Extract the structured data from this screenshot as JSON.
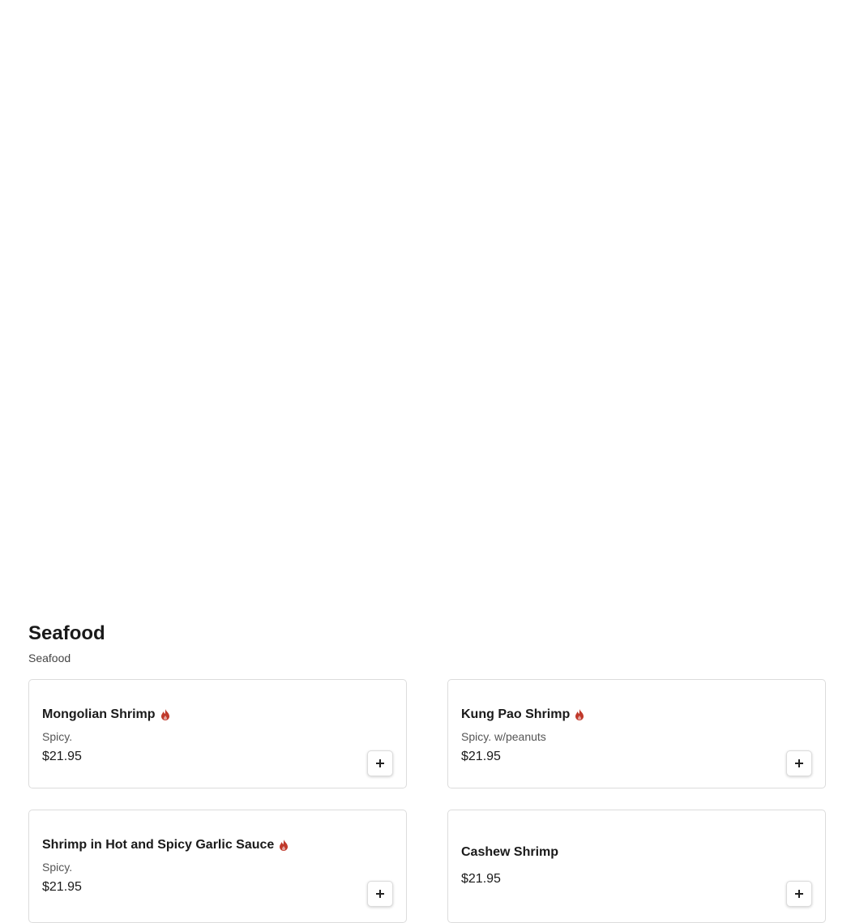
{
  "section": {
    "title": "Seafood",
    "subtitle": "Seafood"
  },
  "items": [
    {
      "name": "Mongolian Shrimp",
      "spicy": true,
      "description": "Spicy.",
      "price": "$21.95",
      "add_icon": "plus-icon"
    },
    {
      "name": "Kung Pao Shrimp",
      "spicy": true,
      "description": "Spicy. w/peanuts",
      "price": "$21.95",
      "add_icon": "plus-icon"
    },
    {
      "name": "Shrimp in Hot and Spicy Garlic Sauce",
      "spicy": true,
      "description": "Spicy.",
      "price": "$21.95",
      "add_icon": "plus-icon"
    },
    {
      "name": "Cashew Shrimp",
      "spicy": false,
      "description": "",
      "price": "$21.95",
      "add_icon": "plus-icon"
    }
  ],
  "colors": {
    "spicy_icon": "#c0392b",
    "text": "#1a1a1a",
    "border": "#dcdcdc"
  }
}
